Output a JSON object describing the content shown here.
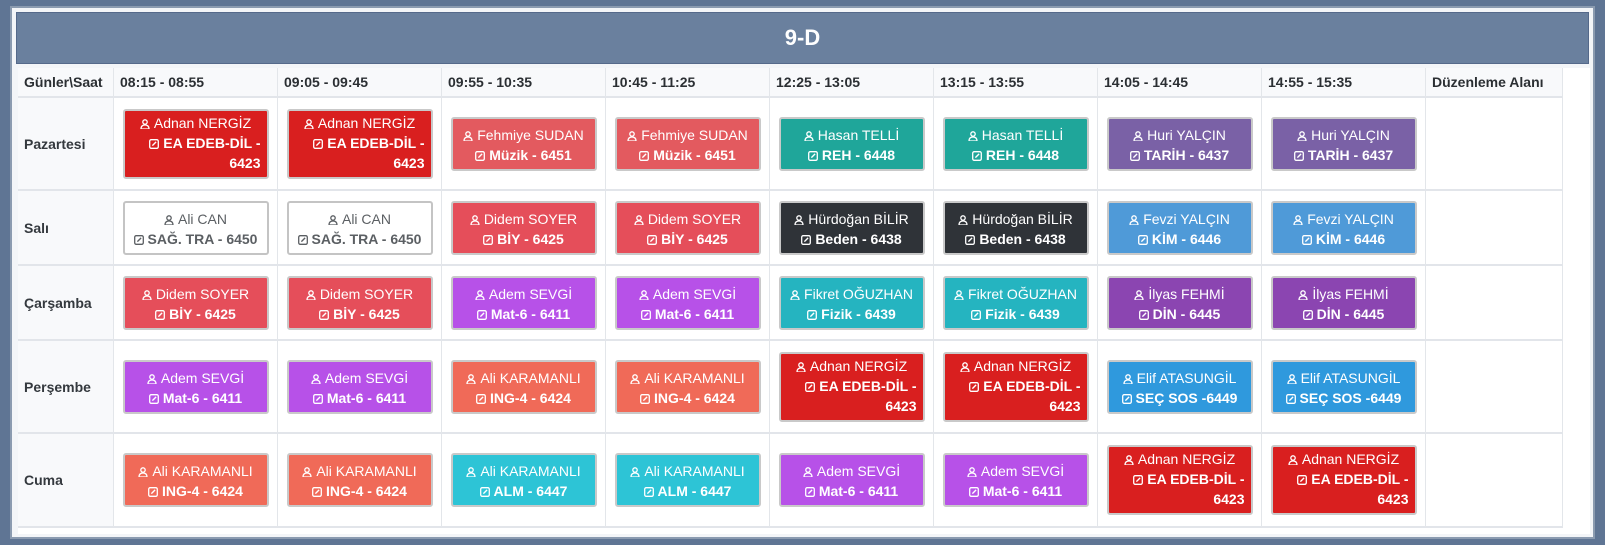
{
  "title": "9-D",
  "corner_label": "Günler\\Saat",
  "edit_label": "Düzenleme Alanı",
  "time_slots": [
    "08:15 - 08:55",
    "09:05 - 09:45",
    "09:55 - 10:35",
    "10:45 - 11:25",
    "12:25 - 13:05",
    "13:15 - 13:55",
    "14:05 - 14:45",
    "14:55 - 15:35"
  ],
  "colors": {
    "ea_edeb": "#d91f1f",
    "muzik": "#e35a5f",
    "reh": "#1fa69a",
    "tarih": "#7a61a6",
    "saglik": "#ffffff",
    "biy": "#e54e5a",
    "beden": "#2f3338",
    "kim": "#4f9ad8",
    "mat": "#b751e8",
    "fizik": "#25b4c0",
    "din": "#8b45b1",
    "ing": "#f06a58",
    "sec": "#2f99dd",
    "alm": "#2dc4d6"
  },
  "days": [
    {
      "name": "Pazartesi",
      "lessons": [
        {
          "teacher": "Adnan NERGİZ",
          "course": "EA EDEB-DİL - 6423",
          "color": "#d91f1f"
        },
        {
          "teacher": "Adnan NERGİZ",
          "course": "EA EDEB-DİL - 6423",
          "color": "#d91f1f"
        },
        {
          "teacher": "Fehmiye SUDAN",
          "course": "Müzik - 6451",
          "color": "#e35a5f"
        },
        {
          "teacher": "Fehmiye SUDAN",
          "course": "Müzik - 6451",
          "color": "#e35a5f"
        },
        {
          "teacher": "Hasan TELLİ",
          "course": "REH - 6448",
          "color": "#1fa69a"
        },
        {
          "teacher": "Hasan TELLİ",
          "course": "REH - 6448",
          "color": "#1fa69a"
        },
        {
          "teacher": "Huri YALÇIN",
          "course": "TARİH - 6437",
          "color": "#7a61a6"
        },
        {
          "teacher": "Huri YALÇIN",
          "course": "TARİH - 6437",
          "color": "#7a61a6"
        }
      ]
    },
    {
      "name": "Salı",
      "lessons": [
        {
          "teacher": "Ali CAN",
          "course": "SAĞ. TRA - 6450",
          "color": "#ffffff"
        },
        {
          "teacher": "Ali CAN",
          "course": "SAĞ. TRA - 6450",
          "color": "#ffffff"
        },
        {
          "teacher": "Didem SOYER",
          "course": "BİY - 6425",
          "color": "#e54e5a"
        },
        {
          "teacher": "Didem SOYER",
          "course": "BİY - 6425",
          "color": "#e54e5a"
        },
        {
          "teacher": "Hürdoğan BİLİR",
          "course": "Beden - 6438",
          "color": "#2f3338"
        },
        {
          "teacher": "Hürdoğan BİLİR",
          "course": "Beden - 6438",
          "color": "#2f3338"
        },
        {
          "teacher": "Fevzi YALÇIN",
          "course": "KİM - 6446",
          "color": "#4f9ad8"
        },
        {
          "teacher": "Fevzi YALÇIN",
          "course": "KİM - 6446",
          "color": "#4f9ad8"
        }
      ]
    },
    {
      "name": "Çarşamba",
      "lessons": [
        {
          "teacher": "Didem SOYER",
          "course": "BİY - 6425",
          "color": "#e54e5a"
        },
        {
          "teacher": "Didem SOYER",
          "course": "BİY - 6425",
          "color": "#e54e5a"
        },
        {
          "teacher": "Adem SEVGİ",
          "course": "Mat-6 - 6411",
          "color": "#b751e8"
        },
        {
          "teacher": "Adem SEVGİ",
          "course": "Mat-6 - 6411",
          "color": "#b751e8"
        },
        {
          "teacher": "Fikret OĞUZHAN",
          "course": "Fizik - 6439",
          "color": "#25b4c0"
        },
        {
          "teacher": "Fikret OĞUZHAN",
          "course": "Fizik - 6439",
          "color": "#25b4c0"
        },
        {
          "teacher": "İlyas FEHMİ",
          "course": "DİN - 6445",
          "color": "#8b45b1"
        },
        {
          "teacher": "İlyas FEHMİ",
          "course": "DİN - 6445",
          "color": "#8b45b1"
        }
      ]
    },
    {
      "name": "Perşembe",
      "lessons": [
        {
          "teacher": "Adem SEVGİ",
          "course": "Mat-6 - 6411",
          "color": "#b751e8"
        },
        {
          "teacher": "Adem SEVGİ",
          "course": "Mat-6 - 6411",
          "color": "#b751e8"
        },
        {
          "teacher": "Ali KARAMANLI",
          "course": "ING-4 - 6424",
          "color": "#f06a58"
        },
        {
          "teacher": "Ali KARAMANLI",
          "course": "ING-4 - 6424",
          "color": "#f06a58"
        },
        {
          "teacher": "Adnan NERGİZ",
          "course": "EA EDEB-DİL - 6423",
          "color": "#d91f1f"
        },
        {
          "teacher": "Adnan NERGİZ",
          "course": "EA EDEB-DİL - 6423",
          "color": "#d91f1f"
        },
        {
          "teacher": "Elif ATASUNGİL",
          "course": "SEÇ SOS  -6449",
          "color": "#2f99dd"
        },
        {
          "teacher": "Elif ATASUNGİL",
          "course": "SEÇ SOS  -6449",
          "color": "#2f99dd"
        }
      ]
    },
    {
      "name": "Cuma",
      "lessons": [
        {
          "teacher": "Ali KARAMANLI",
          "course": "ING-4 - 6424",
          "color": "#f06a58"
        },
        {
          "teacher": "Ali KARAMANLI",
          "course": "ING-4 - 6424",
          "color": "#f06a58"
        },
        {
          "teacher": "Ali KARAMANLI",
          "course": "ALM - 6447",
          "color": "#2dc4d6"
        },
        {
          "teacher": "Ali KARAMANLI",
          "course": "ALM - 6447",
          "color": "#2dc4d6"
        },
        {
          "teacher": "Adem SEVGİ",
          "course": "Mat-6 - 6411",
          "color": "#b751e8"
        },
        {
          "teacher": "Adem SEVGİ",
          "course": "Mat-6 - 6411",
          "color": "#b751e8"
        },
        {
          "teacher": "Adnan NERGİZ",
          "course": "EA EDEB-DİL - 6423",
          "color": "#d91f1f"
        },
        {
          "teacher": "Adnan NERGİZ",
          "course": "EA EDEB-DİL - 6423",
          "color": "#d91f1f"
        }
      ]
    }
  ]
}
